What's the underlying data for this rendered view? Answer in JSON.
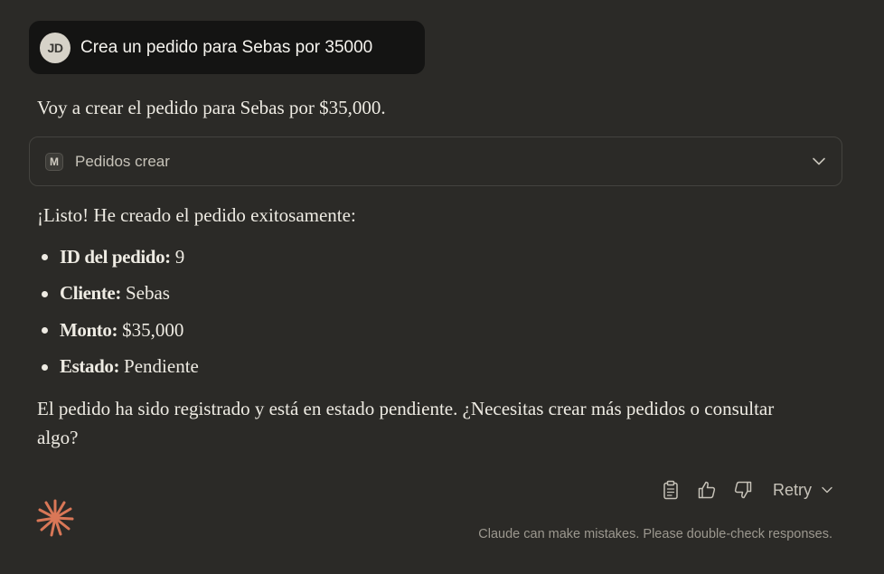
{
  "user_message": {
    "avatar_initials": "JD",
    "text": "Crea un pedido para Sebas por 35000"
  },
  "assistant": {
    "intro": "Voy a crear el pedido para Sebas por $35,000.",
    "tool_call": {
      "icon_letter": "M",
      "label": "Pedidos crear"
    },
    "done": "¡Listo! He creado el pedido exitosamente:",
    "details": [
      {
        "label": "ID del pedido:",
        "value": "9"
      },
      {
        "label": "Cliente:",
        "value": "Sebas"
      },
      {
        "label": "Monto:",
        "value": "$35,000"
      },
      {
        "label": "Estado:",
        "value": "Pendiente"
      }
    ],
    "closing": "El pedido ha sido registrado y está en estado pendiente. ¿Necesitas crear más pedidos o consultar algo?"
  },
  "actions": {
    "retry_label": "Retry"
  },
  "disclaimer": "Claude can make mistakes. Please double-check responses.",
  "colors": {
    "background": "#2b2a27",
    "user_bubble": "#141413",
    "accent": "#d97757"
  },
  "icons": [
    "clipboard-icon",
    "thumbs-up-icon",
    "thumbs-down-icon",
    "chevron-down-icon",
    "claude-logo-icon"
  ]
}
